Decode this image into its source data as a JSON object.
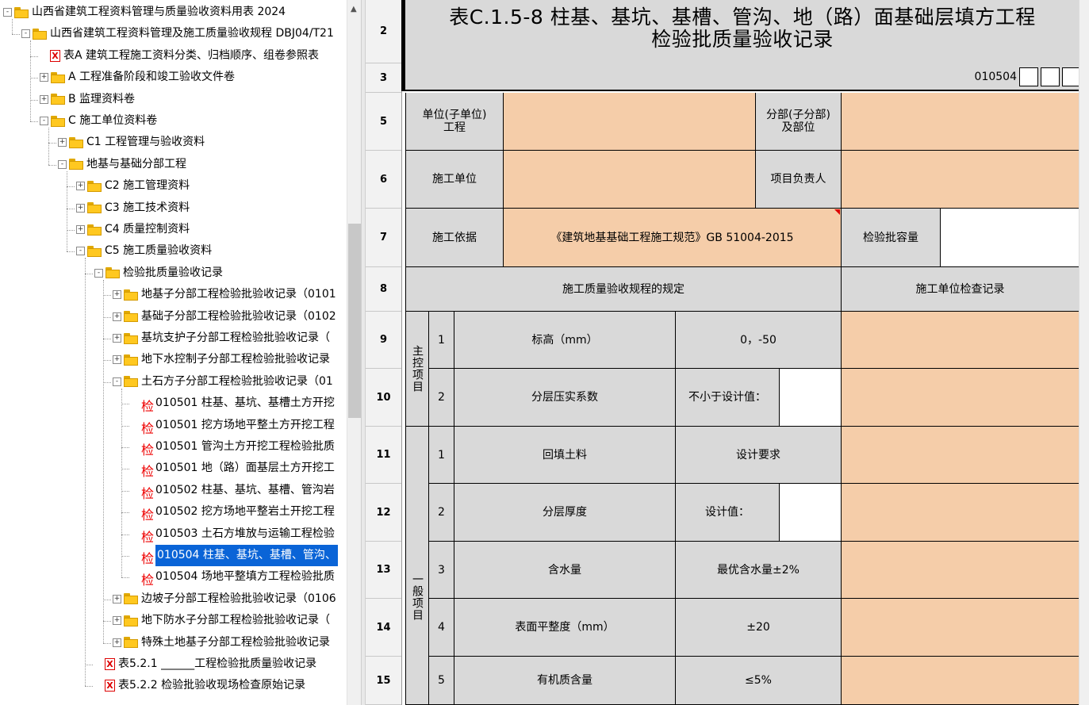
{
  "tree": {
    "items": [
      {
        "label": "山西省建筑工程资料管理与质量验收资料用表 2024",
        "icon": "folder-open-icon",
        "expander": "-"
      },
      {
        "label": "山西省建筑工程资料管理及施工质量验收规程 DBJ04/T21",
        "icon": "folder-open-icon",
        "expander": "-"
      },
      {
        "label": "表A 建筑工程施工资料分类、归档顺序、组卷参照表",
        "icon": "excel-file-icon",
        "expander": ""
      },
      {
        "label": "A 工程准备阶段和竣工验收文件卷",
        "icon": "folder-icon",
        "expander": "+"
      },
      {
        "label": "B 监理资料卷",
        "icon": "folder-icon",
        "expander": "+"
      },
      {
        "label": "C 施工单位资料卷",
        "icon": "folder-open-icon",
        "expander": "-"
      },
      {
        "label": "C1 工程管理与验收资料",
        "icon": "folder-icon",
        "expander": "+"
      },
      {
        "label": "地基与基础分部工程",
        "icon": "folder-open-icon",
        "expander": "-"
      },
      {
        "label": "C2 施工管理资料",
        "icon": "folder-icon",
        "expander": "+"
      },
      {
        "label": "C3 施工技术资料",
        "icon": "folder-icon",
        "expander": "+"
      },
      {
        "label": "C4 质量控制资料",
        "icon": "folder-icon",
        "expander": "+"
      },
      {
        "label": "C5 施工质量验收资料",
        "icon": "folder-open-icon",
        "expander": "-"
      },
      {
        "label": "检验批质量验收记录",
        "icon": "folder-open-icon",
        "expander": "-"
      },
      {
        "label": "地基子分部工程检验批验收记录（0101",
        "icon": "folder-icon",
        "expander": "+"
      },
      {
        "label": "基础子分部工程检验批验收记录（0102",
        "icon": "folder-icon",
        "expander": "+"
      },
      {
        "label": "基坑支护子分部工程检验批验收记录（",
        "icon": "folder-icon",
        "expander": "+"
      },
      {
        "label": "地下水控制子分部工程检验批验收记录",
        "icon": "folder-icon",
        "expander": "+"
      },
      {
        "label": "土石方子分部工程检验批验收记录（01",
        "icon": "folder-open-icon",
        "expander": "-"
      },
      {
        "label": "010501 柱基、基坑、基槽土方开挖",
        "icon": "check-record-icon",
        "expander": ""
      },
      {
        "label": "010501 挖方场地平整土方开挖工程",
        "icon": "check-record-icon",
        "expander": ""
      },
      {
        "label": "010501 管沟土方开挖工程检验批质",
        "icon": "check-record-icon",
        "expander": ""
      },
      {
        "label": "010501 地（路）面基层土方开挖工",
        "icon": "check-record-icon",
        "expander": ""
      },
      {
        "label": "010502 柱基、基坑、基槽、管沟岩",
        "icon": "check-record-icon",
        "expander": ""
      },
      {
        "label": "010502 挖方场地平整岩土开挖工程",
        "icon": "check-record-icon",
        "expander": ""
      },
      {
        "label": "010503 土石方堆放与运输工程检验",
        "icon": "check-record-icon",
        "expander": ""
      },
      {
        "label": "010504 柱基、基坑、基槽、管沟、",
        "icon": "check-record-icon",
        "expander": "",
        "selected": true
      },
      {
        "label": "010504 场地平整填方工程检验批质",
        "icon": "check-record-icon",
        "expander": ""
      },
      {
        "label": "边坡子分部工程检验批验收记录（0106",
        "icon": "folder-icon",
        "expander": "+"
      },
      {
        "label": "地下防水子分部工程检验批验收记录（",
        "icon": "folder-icon",
        "expander": "+"
      },
      {
        "label": "特殊土地基子分部工程检验批验收记录",
        "icon": "folder-icon",
        "expander": "+"
      },
      {
        "label": "表5.2.1 ______工程检验批质量验收记录",
        "icon": "excel-file-icon",
        "expander": ""
      },
      {
        "label": "表5.2.2 检验批验收现场检查原始记录",
        "icon": "excel-file-icon",
        "expander": ""
      }
    ],
    "check_glyph": "检",
    "xls_glyph": "X"
  },
  "sheet": {
    "row_numbers": [
      "2",
      "3",
      "5",
      "6",
      "7",
      "8",
      "9",
      "10",
      "11",
      "12",
      "13",
      "14",
      "15"
    ],
    "title_line1": "表C.1.5-8 柱基、基坑、基槽、管沟、地（路）面基础层填方工程",
    "title_line2": "检验批质量验收记录",
    "code_prefix": "010504",
    "labels": {
      "unit_project": "单位(子单位)\n工程",
      "division_part": "分部(子分部)\n及部位",
      "construction_unit": "施工单位",
      "project_manager": "项目负责人",
      "construction_basis": "施工依据",
      "basis_value": "《建筑地基基础工程施工规范》GB 51004-2015",
      "batch_capacity": "检验批容量",
      "regulation_header": "施工质量验收规程的规定",
      "check_record_header": "施工单位检查记录",
      "main_items": "主控项目",
      "general_items": "一般项目"
    },
    "main_rows": [
      {
        "no": "1",
        "item": "标高（mm）",
        "spec": "0，-50",
        "has_blank": false
      },
      {
        "no": "2",
        "item": "分层压实系数",
        "spec": "不小于设计值：",
        "has_blank": true
      }
    ],
    "general_rows": [
      {
        "no": "1",
        "item": "回填土料",
        "spec": "设计要求",
        "has_blank": false
      },
      {
        "no": "2",
        "item": "分层厚度",
        "spec": "设计值：",
        "has_blank": true
      },
      {
        "no": "3",
        "item": "含水量",
        "spec": "最优含水量±2%",
        "has_blank": false
      },
      {
        "no": "4",
        "item": "表面平整度（mm）",
        "spec": "±20",
        "has_blank": false
      },
      {
        "no": "5",
        "item": "有机质含量",
        "spec": "≤5%",
        "has_blank": false
      }
    ]
  }
}
